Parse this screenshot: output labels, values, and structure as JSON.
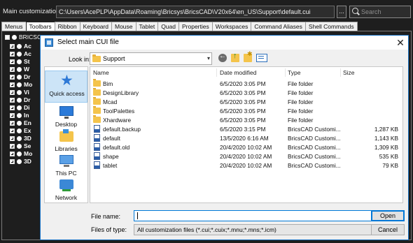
{
  "topbar": {
    "label": "Main customization file:",
    "path": "C:\\Users\\AcePLP\\AppData\\Roaming\\Bricsys\\BricsCAD\\V20x64\\en_US\\Support\\default.cui",
    "browse_label": "...",
    "search_placeholder": "Search"
  },
  "tabs": [
    "Menus",
    "Toolbars",
    "Ribbon",
    "Keyboard",
    "Mouse",
    "Tablet",
    "Quad",
    "Properties",
    "Workspaces",
    "Command Aliases",
    "Shell Commands"
  ],
  "active_tab": "Toolbars",
  "tree": {
    "root_label": "BRICSCAD",
    "rows": [
      "Ac",
      "Ac",
      "St",
      "W",
      "Dr",
      "Mo",
      "Vi",
      "Dr",
      "Di",
      "In",
      "En",
      "Ex",
      "3D",
      "Se",
      "Mo",
      "3D"
    ]
  },
  "dialog": {
    "title": "Select main CUI file",
    "close_glyph": "✕",
    "look_in_label": "Look in:",
    "look_in_value": "Support",
    "places": [
      "Quick access",
      "Desktop",
      "Libraries",
      "This PC",
      "Network"
    ],
    "columns": [
      "Name",
      "Date modified",
      "Type",
      "Size"
    ],
    "files": [
      {
        "icon": "folder-icon",
        "name": "Bim",
        "date": "6/5/2020 3:05 PM",
        "type": "File folder",
        "size": ""
      },
      {
        "icon": "folder-icon",
        "name": "DesignLibrary",
        "date": "6/5/2020 3:05 PM",
        "type": "File folder",
        "size": ""
      },
      {
        "icon": "folder-icon",
        "name": "Mcad",
        "date": "6/5/2020 3:05 PM",
        "type": "File folder",
        "size": ""
      },
      {
        "icon": "folder-icon",
        "name": "ToolPalettes",
        "date": "6/5/2020 3:05 PM",
        "type": "File folder",
        "size": ""
      },
      {
        "icon": "folder-icon",
        "name": "Xhardware",
        "date": "6/5/2020 3:05 PM",
        "type": "File folder",
        "size": ""
      },
      {
        "icon": "cui-file-icon",
        "name": "default.backup",
        "date": "6/5/2020 3:15 PM",
        "type": "BricsCAD Customi...",
        "size": "1,287 KB"
      },
      {
        "icon": "cui-file-icon",
        "name": "default",
        "date": "13/5/2020 6:16 AM",
        "type": "BricsCAD Customi...",
        "size": "1,143 KB"
      },
      {
        "icon": "cui-file-icon",
        "name": "default.old",
        "date": "20/4/2020 10:02 AM",
        "type": "BricsCAD Customi...",
        "size": "1,309 KB"
      },
      {
        "icon": "cui-file-icon",
        "name": "shape",
        "date": "20/4/2020 10:02 AM",
        "type": "BricsCAD Customi...",
        "size": "535 KB"
      },
      {
        "icon": "cui-file-icon",
        "name": "tablet",
        "date": "20/4/2020 10:02 AM",
        "type": "BricsCAD Customi...",
        "size": "79 KB"
      }
    ],
    "file_name_label": "File name:",
    "file_name_value": "",
    "file_type_label": "Files of type:",
    "file_type_value": "All customization files (*.cui;*.cuix;*.mnu;*.mns;*.icm)",
    "open_label": "Open",
    "cancel_label": "Cancel"
  }
}
